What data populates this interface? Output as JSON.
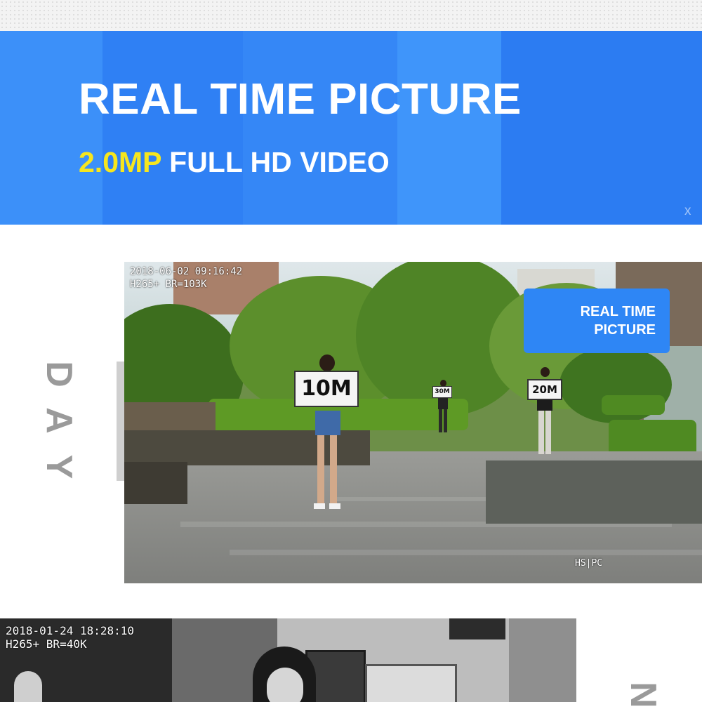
{
  "banner": {
    "title": "REAL TIME PICTURE",
    "subtitle_highlight": "2.0MP",
    "subtitle_rest": " FULL HD VIDEO",
    "close_glyph": "x",
    "colors": {
      "background": "#3a8cf7",
      "highlight": "#f6e61e",
      "text": "#ffffff"
    }
  },
  "day_section": {
    "side_label": [
      "D",
      "A",
      "Y"
    ],
    "photo": {
      "osd_datetime": "2018-06-02 09:16:42",
      "osd_codec": "H265+ BR=103K",
      "watermark": "HS|PC",
      "signs": [
        "10M",
        "20M",
        "30M"
      ]
    },
    "badge": {
      "line1": "REAL TIME",
      "line2": "PICTURE"
    }
  },
  "night_section": {
    "side_label": "N",
    "photo": {
      "osd_datetime": "2018-01-24 18:28:10",
      "osd_codec": "H265+ BR=40K"
    }
  }
}
